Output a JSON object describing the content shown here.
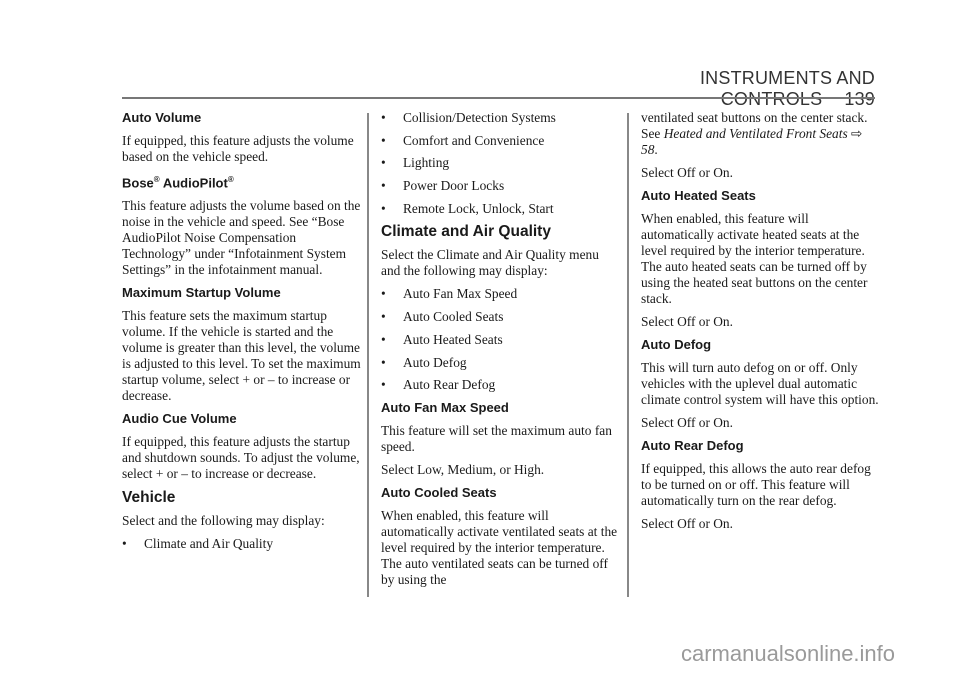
{
  "header": {
    "section": "INSTRUMENTS AND CONTROLS",
    "page_number": "139"
  },
  "col1": {
    "auto_volume_title": "Auto Volume",
    "auto_volume_text": "If equipped, this feature adjusts the volume based on the vehicle speed.",
    "bose_title_a": "Bose",
    "bose_title_b": "AudioPilot",
    "reg": "®",
    "bose_text": "This feature adjusts the volume based on the noise in the vehicle and speed. See “Bose AudioPilot Noise Compensation Technology” under “Infotainment System Settings” in the infotainment manual.",
    "max_title": "Maximum Startup Volume",
    "max_text": "This feature sets the maximum startup volume. If the vehicle is started and the volume is greater than this level, the volume is adjusted to this level. To set the maximum startup volume, select + or – to increase or decrease.",
    "cue_title": "Audio Cue Volume",
    "cue_text": "If equipped, this feature adjusts the startup and shutdown sounds. To adjust the volume, select + or – to increase or decrease.",
    "vehicle_title": "Vehicle",
    "vehicle_text": "Select and the following may display:",
    "vehicle_items": [
      "Climate and Air Quality"
    ]
  },
  "col2": {
    "vehicle_items": [
      "Collision/Detection Systems",
      "Comfort and Convenience",
      "Lighting",
      "Power Door Locks",
      "Remote Lock, Unlock, Start"
    ],
    "climate_title": "Climate and Air Quality",
    "climate_text": "Select the Climate and Air Quality menu and the following may display:",
    "climate_items": [
      "Auto Fan Max Speed",
      "Auto Cooled Seats",
      "Auto Heated Seats",
      "Auto Defog",
      "Auto Rear Defog"
    ],
    "fan_title": "Auto Fan Max Speed",
    "fan_text": "This feature will set the maximum auto fan speed.",
    "fan_select": "Select Low, Medium, or High.",
    "cooled_title": "Auto Cooled Seats",
    "cooled_text": "When enabled, this feature will automatically activate ventilated seats at the level required by the interior temperature. The auto ventilated seats can be turned off by using the"
  },
  "col3": {
    "cooled_cont": "ventilated seat buttons on the center stack. See",
    "xref_title": "Heated and Ventilated Front Seats",
    "xref_page": "58",
    "select1": "Select Off or On.",
    "heated_title": "Auto Heated Seats",
    "heated_text": "When enabled, this feature will automatically activate heated seats at the level required by the interior temperature. The auto heated seats can be turned off by using the heated seat buttons on the center stack.",
    "select2": "Select Off or On.",
    "defog_title": "Auto Defog",
    "defog_text": "This will turn auto defog on or off. Only vehicles with the uplevel dual automatic climate control system will have this option.",
    "select3": "Select Off or On.",
    "rear_title": "Auto Rear Defog",
    "rear_text": "If equipped, this allows the auto rear defog to be turned on or off. This feature will automatically turn on the rear defog.",
    "select4": "Select Off or On."
  },
  "bullet": "•",
  "xref_arrow": "⇨",
  "watermark": "carmanualsonline.info"
}
